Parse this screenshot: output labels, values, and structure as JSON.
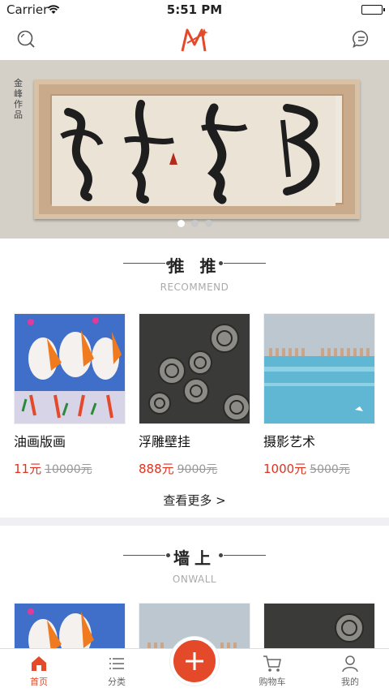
{
  "status_bar": {
    "carrier": "Carrier",
    "time": "5:51 PM"
  },
  "header": {
    "icons": [
      "search-icon",
      "app-logo",
      "message-icon"
    ]
  },
  "banner": {
    "side_text": "金峰作品",
    "slides": 3,
    "active_slide": 1
  },
  "recommend": {
    "title": "推 推",
    "subtitle": "RECOMMEND",
    "items": [
      {
        "name": "油画版画",
        "price": "11元",
        "old_price": "10000元"
      },
      {
        "name": "浮雕壁挂",
        "price": "888元",
        "old_price": "9000元"
      },
      {
        "name": "摄影艺术",
        "price": "1000元",
        "old_price": "5000元"
      }
    ],
    "more": "查看更多 >"
  },
  "onwall": {
    "title": "墙上",
    "subtitle": "ONWALL"
  },
  "tabbar": {
    "tabs": [
      {
        "label": "首页",
        "icon": "home-icon",
        "active": true
      },
      {
        "label": "分类",
        "icon": "list-icon",
        "active": false
      },
      {
        "label": "",
        "icon": "plus-icon",
        "active": false
      },
      {
        "label": "购物车",
        "icon": "cart-icon",
        "active": false
      },
      {
        "label": "我的",
        "icon": "user-icon",
        "active": false
      }
    ]
  },
  "colors": {
    "accent": "#e4492a",
    "price": "#e0311f",
    "divider": "#efeff4"
  }
}
